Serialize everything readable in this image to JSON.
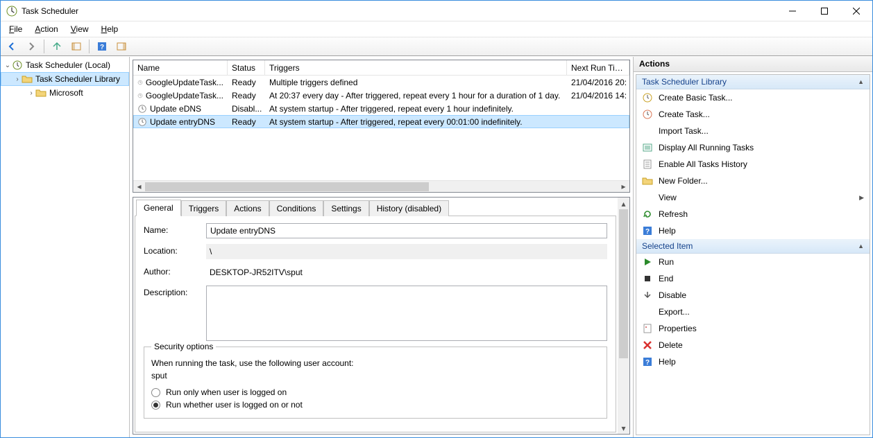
{
  "window": {
    "title": "Task Scheduler"
  },
  "menus": {
    "file": "File",
    "action": "Action",
    "view": "View",
    "help": "Help"
  },
  "tree": {
    "root": "Task Scheduler (Local)",
    "library": "Task Scheduler Library",
    "microsoft": "Microsoft"
  },
  "columns": {
    "name": "Name",
    "status": "Status",
    "triggers": "Triggers",
    "next": "Next Run Time"
  },
  "tasks": [
    {
      "name": "GoogleUpdateTask...",
      "status": "Ready",
      "triggers": "Multiple triggers defined",
      "next": "21/04/2016 20:"
    },
    {
      "name": "GoogleUpdateTask...",
      "status": "Ready",
      "triggers": "At 20:37 every day - After triggered, repeat every 1 hour for a duration of 1 day.",
      "next": "21/04/2016 14:"
    },
    {
      "name": "Update eDNS",
      "status": "Disabl...",
      "triggers": "At system startup - After triggered, repeat every 1 hour indefinitely.",
      "next": ""
    },
    {
      "name": "Update entryDNS",
      "status": "Ready",
      "triggers": "At system startup - After triggered, repeat every 00:01:00 indefinitely.",
      "next": ""
    }
  ],
  "tabs": {
    "general": "General",
    "triggers": "Triggers",
    "actions": "Actions",
    "conditions": "Conditions",
    "settings": "Settings",
    "history": "History (disabled)"
  },
  "general": {
    "name_label": "Name:",
    "name_value": "Update entryDNS",
    "location_label": "Location:",
    "location_value": "\\",
    "author_label": "Author:",
    "author_value": "DESKTOP-JR52ITV\\sput",
    "description_label": "Description:",
    "security_legend": "Security options",
    "security_hint": "When running the task, use the following user account:",
    "account": "sput",
    "radio_logged_on": "Run only when user is logged on",
    "radio_logged_or_not": "Run whether user is logged on or not"
  },
  "actions_pane": {
    "header": "Actions",
    "section1": "Task Scheduler Library",
    "items1": [
      {
        "icon": "create-basic-icon",
        "label": "Create Basic Task..."
      },
      {
        "icon": "create-task-icon",
        "label": "Create Task..."
      },
      {
        "icon": "import-icon",
        "label": "Import Task..."
      },
      {
        "icon": "display-running-icon",
        "label": "Display All Running Tasks"
      },
      {
        "icon": "enable-history-icon",
        "label": "Enable All Tasks History"
      },
      {
        "icon": "new-folder-icon",
        "label": "New Folder..."
      },
      {
        "icon": "view-icon",
        "label": "View",
        "submenu": true
      },
      {
        "icon": "refresh-icon",
        "label": "Refresh"
      },
      {
        "icon": "help-icon",
        "label": "Help"
      }
    ],
    "section2": "Selected Item",
    "items2": [
      {
        "icon": "run-icon",
        "label": "Run"
      },
      {
        "icon": "end-icon",
        "label": "End"
      },
      {
        "icon": "disable-icon",
        "label": "Disable"
      },
      {
        "icon": "export-icon",
        "label": "Export..."
      },
      {
        "icon": "properties-icon",
        "label": "Properties"
      },
      {
        "icon": "delete-icon",
        "label": "Delete"
      },
      {
        "icon": "help-icon",
        "label": "Help"
      }
    ]
  }
}
